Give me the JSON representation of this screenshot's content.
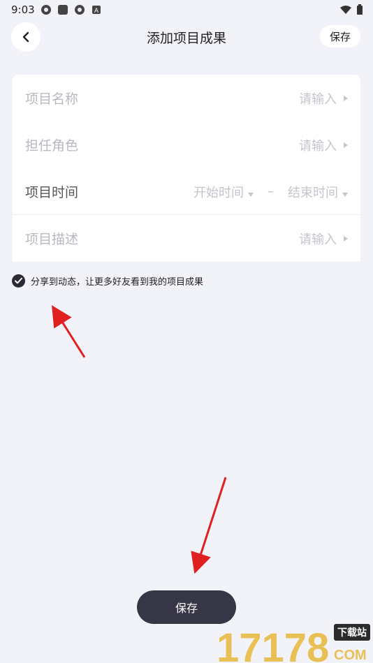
{
  "status_bar": {
    "time": "9:03",
    "icons": [
      "aperture-icon",
      "square-icon",
      "aperture-icon",
      "a-badge-icon"
    ],
    "right_icons": [
      "wifi-icon",
      "battery-icon"
    ]
  },
  "header": {
    "title": "添加项目成果",
    "save_label": "保存"
  },
  "form": {
    "project_name": {
      "label": "项目名称",
      "value": "请输入"
    },
    "role": {
      "label": "担任角色",
      "value": "请输入"
    },
    "project_time": {
      "label": "项目时间",
      "start": "开始时间",
      "separator": "–",
      "end": "结束时间"
    },
    "description": {
      "label": "项目描述",
      "value": "请输入"
    }
  },
  "share": {
    "text": "分享到动态，让更多好友看到我的项目成果",
    "checked": true
  },
  "bottom": {
    "save_label": "保存"
  },
  "watermark": {
    "number": "17178",
    "badge": "下载站",
    "domain": "COM"
  },
  "colors": {
    "accent_dark": "#363646",
    "background": "#f2f3f8",
    "arrow": "#e02020"
  }
}
